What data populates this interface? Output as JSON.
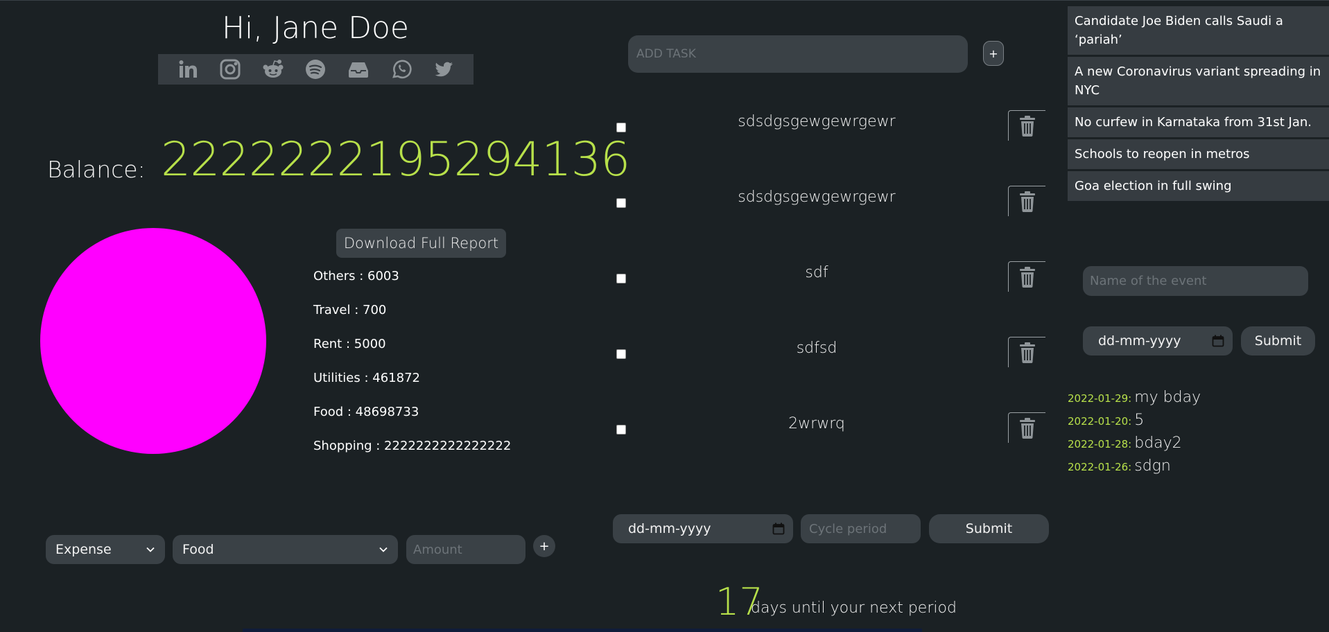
{
  "greeting": "Hi, Jane Doe",
  "social": [
    "linkedin-icon",
    "instagram-icon",
    "reddit-icon",
    "spotify-icon",
    "inbox-icon",
    "whatsapp-icon",
    "twitter-icon"
  ],
  "balance": {
    "label": "Balance:",
    "value": "2222222195294136"
  },
  "report_button": "Download Full Report",
  "categories": [
    {
      "label": "Others : 6003"
    },
    {
      "label": "Travel : 700"
    },
    {
      "label": "Rent : 5000"
    },
    {
      "label": "Utilities : 461872"
    },
    {
      "label": "Food : 48698733"
    },
    {
      "label": "Shopping : 2222222222222222"
    }
  ],
  "pie": {
    "color": "#ff00ff"
  },
  "expense_form": {
    "type": "Expense",
    "category": "Food",
    "amount_placeholder": "Amount",
    "add": "+"
  },
  "tasks": {
    "placeholder": "ADD TASK",
    "add": "+",
    "items": [
      {
        "text": "sdsdgsgewgewrgewr"
      },
      {
        "text": "sdsdgsgewgewrgewr"
      },
      {
        "text": "sdf"
      },
      {
        "text": "sdfsd"
      },
      {
        "text": "2wrwrq"
      }
    ]
  },
  "period": {
    "date_placeholder": "dd-mm-yyyy",
    "cycle_placeholder": "Cycle period",
    "submit": "Submit",
    "days": "17",
    "text": "days until your next period"
  },
  "news": [
    "Candidate Joe Biden calls Saudi a ‘pariah’",
    "A new Coronavirus variant spreading in NYC",
    "No curfew in Karnataka from 31st Jan.",
    "Schools to reopen in metros",
    "Goa election in full swing"
  ],
  "event_form": {
    "name_placeholder": "Name of the event",
    "date_placeholder": "dd-mm-yyyy",
    "submit": "Submit"
  },
  "events": [
    {
      "date": "2022-01-29:",
      "name": "my bday"
    },
    {
      "date": "2022-01-20:",
      "name": "5"
    },
    {
      "date": "2022-01-28:",
      "name": "bday2"
    },
    {
      "date": "2022-01-26:",
      "name": "sdgn"
    }
  ],
  "colors": {
    "accent": "#b7e04a",
    "background": "#1b2124",
    "panel": "#3a4146"
  }
}
